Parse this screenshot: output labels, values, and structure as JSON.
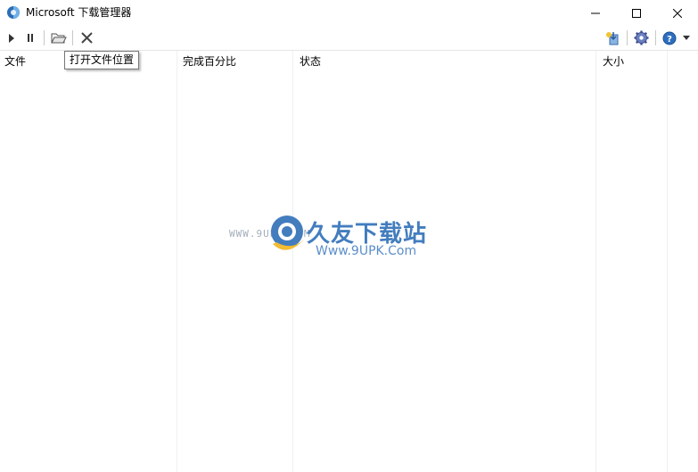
{
  "window": {
    "title": "Microsoft 下载管理器",
    "icon": "globe-app-icon"
  },
  "toolbar": {
    "items": [
      "play-icon",
      "pause-icon",
      "open-folder-icon",
      "delete-icon",
      "add-download-icon",
      "settings-gear-icon",
      "help-icon",
      "chevron-down-icon"
    ]
  },
  "tooltip": {
    "text": "打开文件位置"
  },
  "list": {
    "columns": [
      "文件",
      "完成百分比",
      "状态",
      "大小"
    ],
    "rows": []
  },
  "watermark": {
    "small_text": "WWW.9UPK.COM",
    "brand_text": "久友下载站",
    "url_text": "Www.9UPK.Com"
  },
  "colors": {
    "accent": "#2f6fb7",
    "separator": "#c8c8c8",
    "gridline": "#f0f0f0"
  }
}
